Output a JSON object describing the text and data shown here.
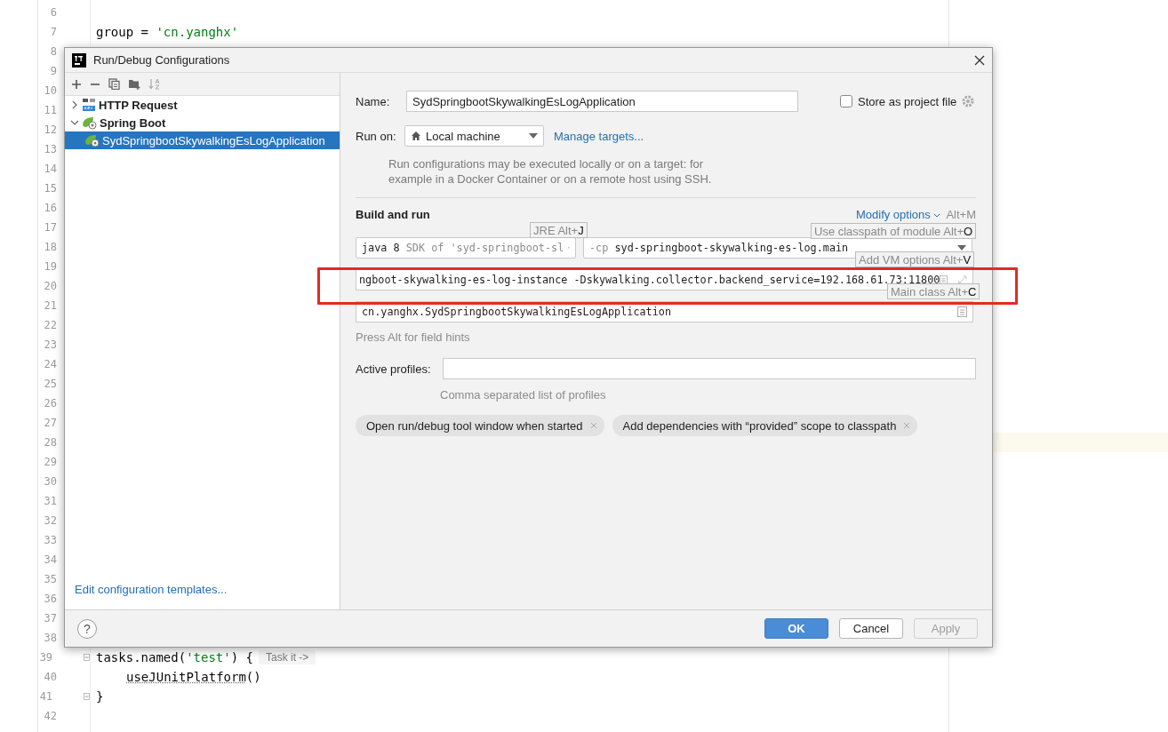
{
  "editor": {
    "lines": [
      {
        "number": "6",
        "fold_marker": false,
        "current": false
      },
      {
        "number": "7",
        "fold_marker": false,
        "current": false,
        "tokens": [
          {
            "text": "group = ",
            "kind": "plain"
          },
          {
            "text": "'cn.yanghx'",
            "kind": "string"
          }
        ]
      },
      {
        "number": "8",
        "fold_marker": false,
        "current": false
      },
      {
        "number": "9",
        "fold_marker": false,
        "current": false
      },
      {
        "number": "10",
        "fold_marker": false,
        "current": false
      },
      {
        "number": "11",
        "fold_marker": false,
        "current": false
      },
      {
        "number": "12",
        "fold_marker": false,
        "current": false
      },
      {
        "number": "13",
        "fold_marker": false,
        "current": false
      },
      {
        "number": "14",
        "fold_marker": false,
        "current": false
      },
      {
        "number": "15",
        "fold_marker": false,
        "current": false
      },
      {
        "number": "16",
        "fold_marker": false,
        "current": false
      },
      {
        "number": "17",
        "fold_marker": false,
        "current": false
      },
      {
        "number": "18",
        "fold_marker": false,
        "current": false
      },
      {
        "number": "19",
        "fold_marker": false,
        "current": false
      },
      {
        "number": "20",
        "fold_marker": false,
        "current": false
      },
      {
        "number": "21",
        "fold_marker": false,
        "current": false
      },
      {
        "number": "22",
        "fold_marker": false,
        "current": false
      },
      {
        "number": "23",
        "fold_marker": false,
        "current": false
      },
      {
        "number": "24",
        "fold_marker": false,
        "current": false
      },
      {
        "number": "25",
        "fold_marker": false,
        "current": false
      },
      {
        "number": "26",
        "fold_marker": false,
        "current": false
      },
      {
        "number": "27",
        "fold_marker": false,
        "current": false
      },
      {
        "number": "28",
        "fold_marker": false,
        "current": true
      },
      {
        "number": "29",
        "fold_marker": false,
        "current": false
      },
      {
        "number": "30",
        "fold_marker": false,
        "current": false
      },
      {
        "number": "31",
        "fold_marker": false,
        "current": false
      },
      {
        "number": "32",
        "fold_marker": false,
        "current": false
      },
      {
        "number": "33",
        "fold_marker": false,
        "current": false
      },
      {
        "number": "34",
        "fold_marker": false,
        "current": false
      },
      {
        "number": "35",
        "fold_marker": false,
        "current": false
      },
      {
        "number": "36",
        "fold_marker": false,
        "current": false
      },
      {
        "number": "37",
        "fold_marker": false,
        "current": false
      },
      {
        "number": "38",
        "fold_marker": false,
        "current": false
      },
      {
        "number": "39",
        "fold_marker": true,
        "current": false,
        "tokens": [
          {
            "text": "tasks.named(",
            "kind": "plain"
          },
          {
            "text": "'test'",
            "kind": "string"
          },
          {
            "text": ") {",
            "kind": "plain"
          },
          {
            "text": "Task it ->",
            "kind": "hint"
          }
        ],
        "children": [
          {
            "number": "40",
            "fold_marker": false,
            "current": false,
            "tokens": [
              {
                "text": "useJUnitPlatform",
                "kind": "unresolved"
              },
              {
                "text": "()",
                "kind": "plain"
              }
            ]
          }
        ]
      },
      {
        "number": "41",
        "fold_marker": true,
        "current": false,
        "tokens": [
          {
            "text": "}",
            "kind": "plain"
          }
        ]
      },
      {
        "number": "42",
        "fold_marker": false,
        "current": false
      }
    ]
  },
  "dialog": {
    "title": "Run/Debug Configurations",
    "tree": [
      {
        "label": "HTTP Request",
        "kind": "http",
        "expanded": false,
        "selected": false
      },
      {
        "label": "Spring Boot",
        "kind": "spring",
        "expanded": true,
        "selected": false,
        "children": [
          {
            "label": "SydSpringbootSkywalkingEsLogApplication",
            "kind": "spring-app",
            "selected": true
          }
        ]
      }
    ],
    "templates_link": "Edit configuration templates...",
    "name": {
      "label": "Name:",
      "value": "SydSpringbootSkywalkingEsLogApplication"
    },
    "store_as_project": {
      "label": "Store as project file",
      "checked": false
    },
    "run_on": {
      "label": "Run on:",
      "value": "Local machine",
      "link": "Manage targets..."
    },
    "run_on_hint": "Run configurations may be executed locally or on a target: for example in a Docker Container or on a remote host using SSH.",
    "section_title": "Build and run",
    "modify_options": {
      "label": "Modify options",
      "shortcut": "Alt+M"
    },
    "jre": {
      "version": "java 8",
      "detail": "SDK of 'syd-springboot-sl"
    },
    "classpath": {
      "flag": "-cp",
      "value": "syd-springboot-skywalking-es-log.main"
    },
    "vm_options": {
      "value": "ngboot-skywalking-es-log-instance -Dskywalking.collector.backend_service=192.168.61.73:11800"
    },
    "main_class": {
      "value": "cn.yanghx.SydSpringbootSkywalkingEsLogApplication"
    },
    "field_hint": "Press Alt for field hints",
    "active_profiles": {
      "label": "Active profiles:",
      "hint": "Comma separated list of profiles"
    },
    "chips": [
      "Open run/debug tool window when started",
      "Add dependencies with “provided” scope to classpath"
    ],
    "tooltips": [
      {
        "text": "JRE Alt+",
        "mnemonic": "J"
      },
      {
        "text": "Use classpath of module Alt+",
        "mnemonic": "O"
      },
      {
        "text": "Add VM options Alt+",
        "mnemonic": "V"
      },
      {
        "text": "Main class Alt+",
        "mnemonic": "C"
      }
    ],
    "help": "?",
    "buttons": [
      {
        "label": "OK",
        "kind": "default",
        "disabled": false
      },
      {
        "label": "Cancel",
        "kind": "normal",
        "disabled": false
      },
      {
        "label": "Apply",
        "kind": "normal",
        "disabled": true
      }
    ]
  }
}
